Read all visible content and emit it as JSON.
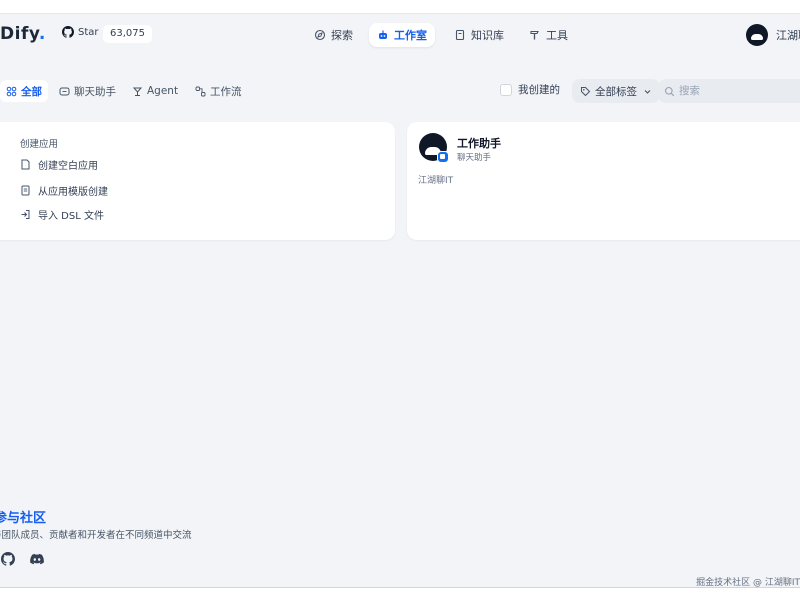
{
  "header": {
    "logo_text": "Dify",
    "logo_dot": ".",
    "github_star_label": "Star",
    "github_star_count": "63,075",
    "nav": [
      {
        "label": "探索",
        "icon": "explore-icon",
        "active": false
      },
      {
        "label": "工作室",
        "icon": "robot-icon",
        "active": true
      },
      {
        "label": "知识库",
        "icon": "book-icon",
        "active": false
      },
      {
        "label": "工具",
        "icon": "hammer-icon",
        "active": false
      }
    ],
    "user_name": "江湖聊IT"
  },
  "filters": {
    "tabs": [
      {
        "label": "全部",
        "active": true
      },
      {
        "label": "聊天助手",
        "active": false
      },
      {
        "label": "Agent",
        "active": false
      },
      {
        "label": "工作流",
        "active": false
      }
    ],
    "created_by_me_label": "我创建的",
    "tags_label": "全部标签",
    "search_placeholder": "搜索"
  },
  "create_card": {
    "title": "创建应用",
    "items": [
      {
        "label": "创建空白应用",
        "icon": "blank-file-icon"
      },
      {
        "label": "从应用模版创建",
        "icon": "template-icon"
      },
      {
        "label": "导入 DSL 文件",
        "icon": "import-icon"
      }
    ]
  },
  "apps": [
    {
      "name": "工作助手",
      "type": "聊天助手",
      "description": "江湖聊IT"
    }
  ],
  "community": {
    "title": "参与社区",
    "description": "与团队成员、贡献者和开发者在不同频道中交流"
  },
  "watermark": "掘金技术社区 @ 江湖聊IT",
  "colors": {
    "accent": "#155eef",
    "background": "#f2f4f7"
  }
}
